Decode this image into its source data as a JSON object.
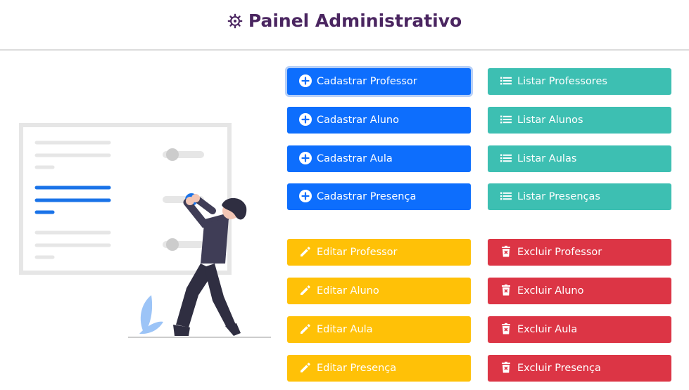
{
  "header": {
    "title": "Painel Administrativo"
  },
  "actions": {
    "cadastrar_professor": "Cadastrar Professor",
    "cadastrar_aluno": "Cadastrar Aluno",
    "cadastrar_aula": "Cadastrar Aula",
    "cadastrar_presenca": "Cadastrar Presença",
    "listar_professores": "Listar Professores",
    "listar_alunos": "Listar Alunos",
    "listar_aulas": "Listar Aulas",
    "listar_presencas": "Listar Presenças",
    "editar_professor": "Editar Professor",
    "editar_aluno": "Editar Aluno",
    "editar_aula": "Editar Aula",
    "editar_presenca": "Editar Presença",
    "excluir_professor": "Excluir Professor",
    "excluir_aluno": "Excluir Aluno",
    "excluir_aula": "Excluir Aula",
    "excluir_presenca": "Excluir Presença"
  },
  "icons": {
    "header": "gear-icon",
    "cadastrar": "plus-circle-icon",
    "listar": "list-icon",
    "editar": "pencil-icon",
    "excluir": "trash-icon"
  },
  "colors": {
    "title": "#4a2560",
    "cadastrar": "#0d6efd",
    "listar": "#3dbfb2",
    "editar": "#ffc107",
    "excluir": "#dc3545"
  }
}
